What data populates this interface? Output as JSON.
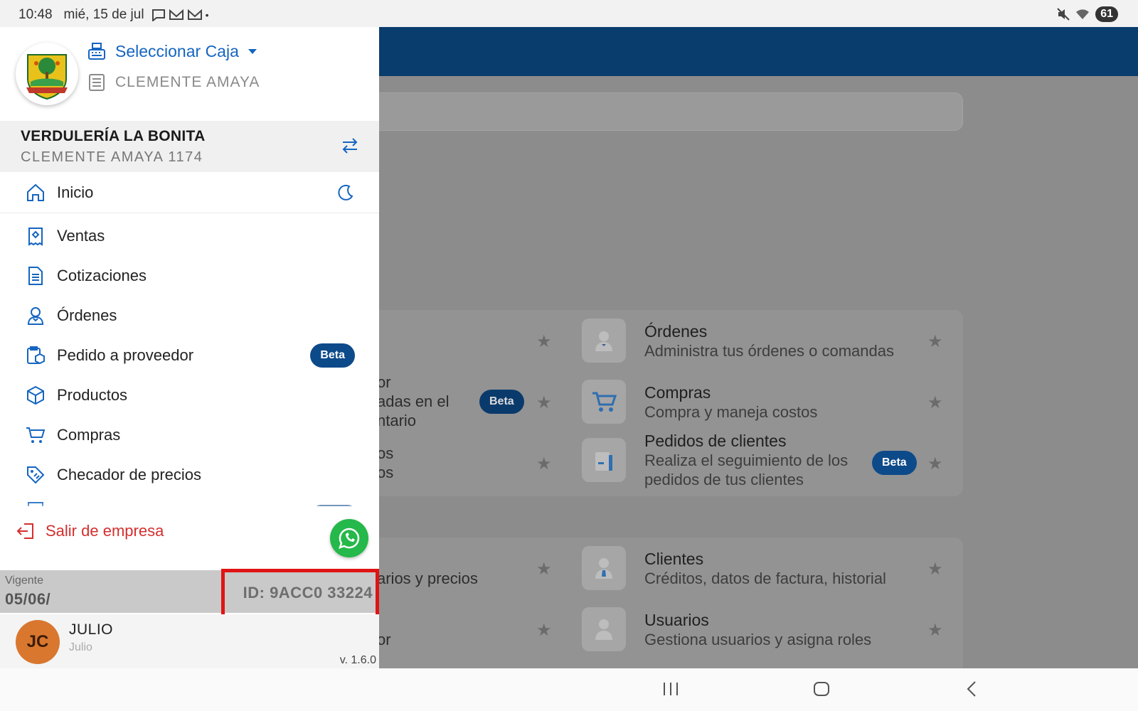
{
  "status": {
    "time": "10:48",
    "date": "mié, 15 de jul",
    "battery": "61"
  },
  "drawer": {
    "select_box_label": "Seleccionar Caja",
    "box_name": "CLEMENTE AMAYA",
    "company_name": "VERDULERÍA LA BONITA",
    "company_sub": "CLEMENTE AMAYA 1174",
    "menu": [
      {
        "label": "Inicio",
        "icon": "home-icon"
      },
      {
        "label": "Ventas",
        "icon": "receipt-icon"
      },
      {
        "label": "Cotizaciones",
        "icon": "document-icon"
      },
      {
        "label": "Órdenes",
        "icon": "waiter-icon"
      },
      {
        "label": "Pedido a proveedor",
        "icon": "clipboard-box-icon",
        "badge": "Beta"
      },
      {
        "label": "Productos",
        "icon": "cube-icon"
      },
      {
        "label": "Compras",
        "icon": "cart-icon"
      },
      {
        "label": "Checador de precios",
        "icon": "price-tag-icon"
      }
    ],
    "logout_label": "Salir de empresa",
    "vigente_label": "Vigente",
    "vigente_date": "05/06/",
    "id_text": "ID: 9ACC0 33224",
    "user_initials": "JC",
    "user_name": "JULIO",
    "user_sub": "Julio",
    "version": "v. 1.6.0"
  },
  "background": {
    "tiles": [
      {
        "title": "Órdenes",
        "sub": "Administra tus órdenes o comandas"
      },
      {
        "title": "Compras",
        "sub": "Compra y maneja costos"
      },
      {
        "title": "Pedidos de clientes",
        "sub1": "Realiza el seguimiento de los",
        "sub2": "pedidos de tus clientes",
        "badge": "Beta"
      },
      {
        "title": "Clientes",
        "sub": "Créditos, datos de factura, historial"
      },
      {
        "title": "Usuarios",
        "sub": "Gestiona usuarios y asigna roles"
      }
    ],
    "fragments": {
      "f1": "or",
      "f2": "adas en el",
      "f3": "ntario",
      "f4": "os",
      "f5": "os",
      "f6": "arios y precios",
      "f7": "or",
      "badge_left": "Beta"
    }
  },
  "colors": {
    "header": "#093d6d",
    "accent": "#1565c0",
    "danger": "#d32f2f",
    "whatsapp": "#25b84a",
    "highlight": "#e01414"
  }
}
